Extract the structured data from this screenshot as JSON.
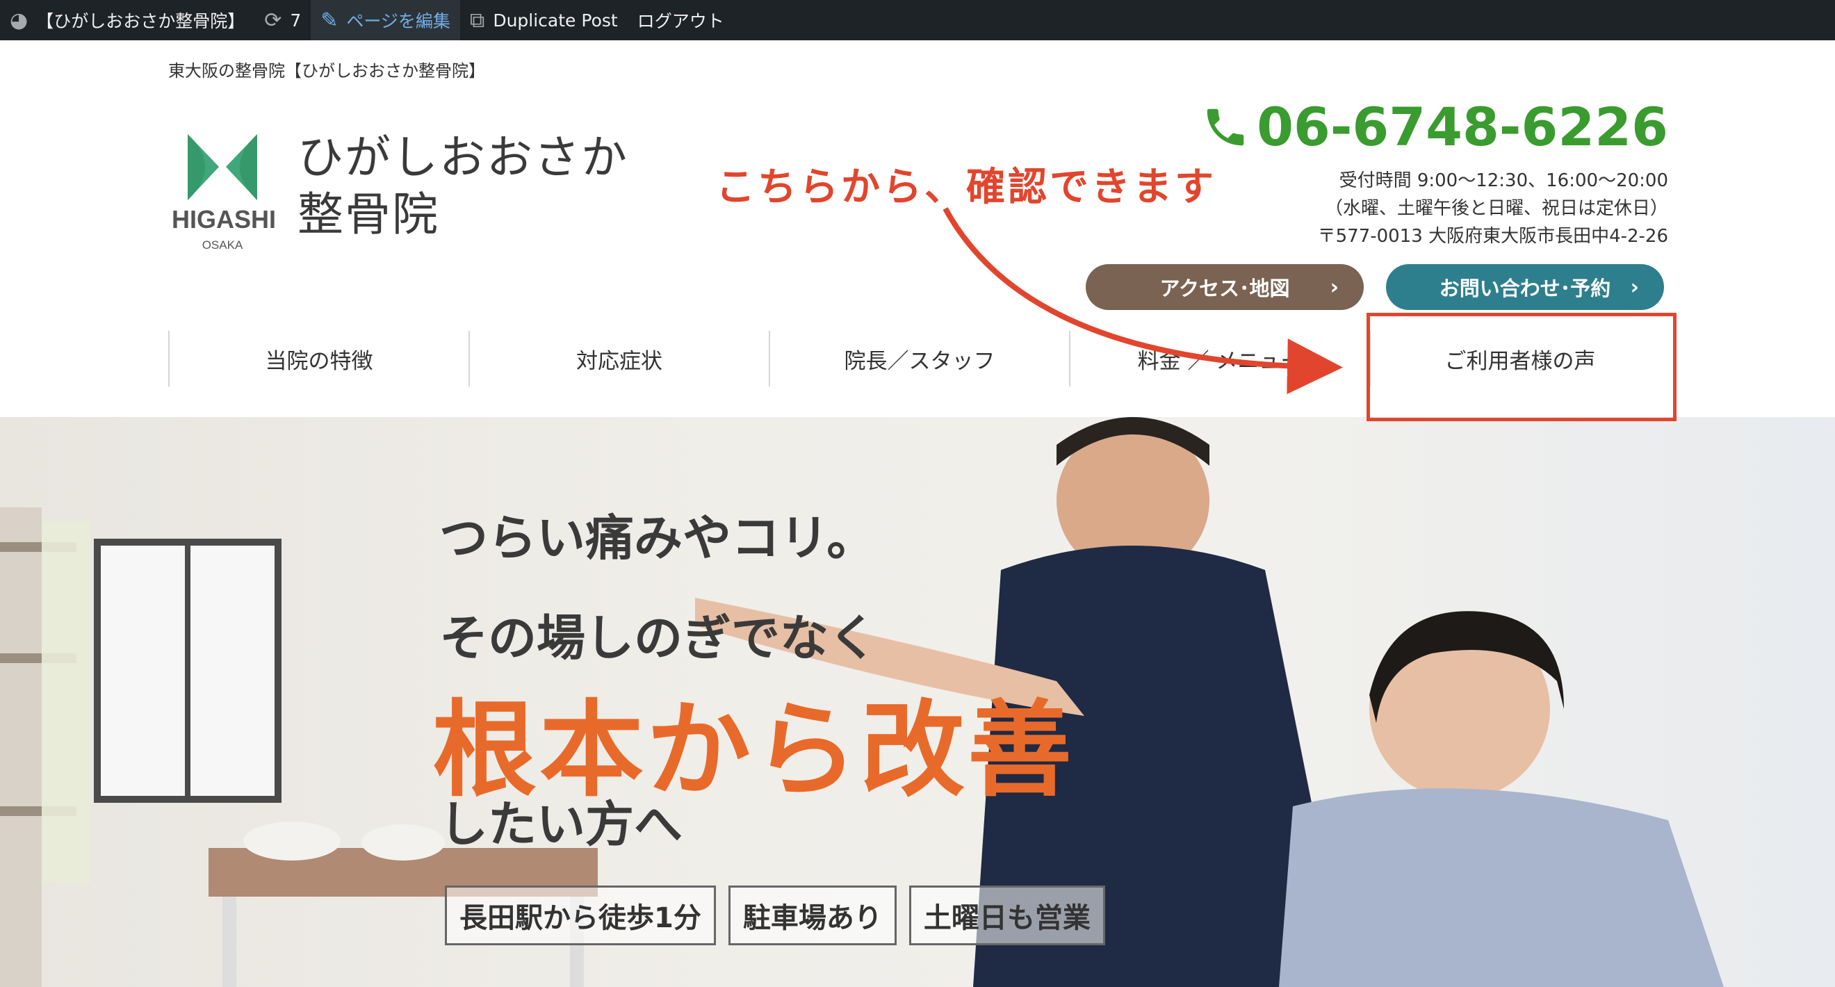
{
  "admin_bar": {
    "site_title": "【ひがしおおさか整骨院】",
    "update_count": "7",
    "edit_page": "ページを編集",
    "duplicate_post": "Duplicate Post",
    "logout": "ログアウト"
  },
  "header": {
    "tagline": "東大阪の整骨院【ひがしおおさか整骨院】",
    "logo_text_main": "HIGASHI",
    "logo_text_sub": "OSAKA",
    "site_name_line1": "ひがしおおさか",
    "site_name_line2": "整骨院",
    "phone": "06-6748-6226",
    "hours": "受付時間 9:00〜12:30、16:00〜20:00",
    "holidays": "（水曜、土曜午後と日曜、祝日は定休日）",
    "address": "〒577-0013 大阪府東大阪市長田中4-2-26",
    "btn_access": "アクセス･地図",
    "btn_contact": "お問い合わせ･予約"
  },
  "nav": {
    "items": [
      {
        "label": "当院の特徴"
      },
      {
        "label": "対応症状"
      },
      {
        "label": "院長／スタッフ"
      },
      {
        "label": "料金 ／ メニュー"
      },
      {
        "label": "ご利用者様の声"
      }
    ]
  },
  "annotation": {
    "text": "こちらから、確認できます"
  },
  "hero": {
    "line1": "つらい痛みやコリ。",
    "line2": "その場しのぎでなく",
    "main": "根本から改善",
    "line3": "したい方へ",
    "tags": [
      "長田駅から徒歩1分",
      "駐車場あり",
      "土曜日も営業"
    ]
  },
  "colors": {
    "admin_bar_bg": "#1d2327",
    "phone_green": "#3a9b2f",
    "accent_red": "#e2452d",
    "hero_orange": "#e86a2a",
    "pill_brown": "#7a6352",
    "pill_teal": "#2e7f8d",
    "logo_green": "#3fa77a"
  }
}
